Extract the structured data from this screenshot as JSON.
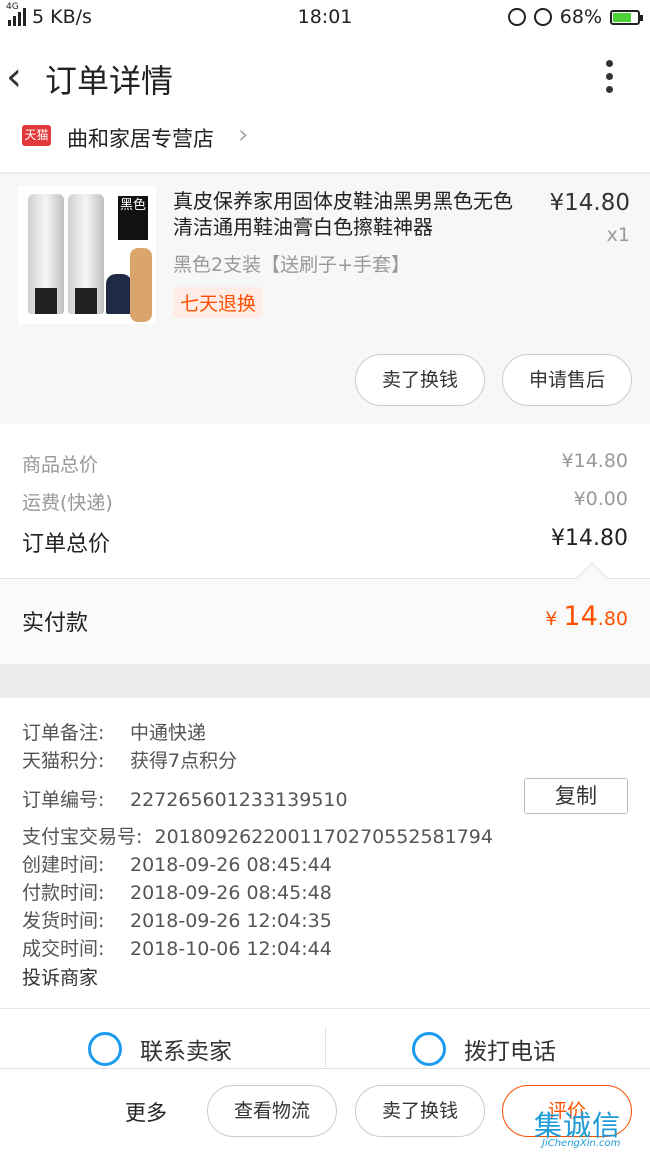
{
  "status_bar": {
    "network": "4G",
    "speed": "5 KB/s",
    "time": "18:01",
    "battery": "68%"
  },
  "nav": {
    "title": "订单详情"
  },
  "shop": {
    "badge": "天猫",
    "name": "曲和家居专营店"
  },
  "product": {
    "title": "真皮保养家用固体皮鞋油黑男黑色无色清洁通用鞋油膏白色擦鞋神器",
    "price": "¥14.80",
    "qty": "x1",
    "sku": "黑色2支装【送刷子+手套】",
    "tag": "七天退换",
    "image_label": "黑色",
    "actions": {
      "sell": "卖了换钱",
      "after_sale": "申请售后"
    }
  },
  "summary": {
    "goods_label": "商品总价",
    "goods_value": "¥14.80",
    "shipping_label": "运费(快递)",
    "shipping_value": "¥0.00",
    "total_label": "订单总价",
    "total_value": "¥14.80"
  },
  "paid": {
    "label": "实付款",
    "currency": "¥",
    "int": "14",
    "dec": ".80"
  },
  "info": {
    "remark": {
      "k": "订单备注:",
      "v": "中通快递"
    },
    "points": {
      "k": "天猫积分:",
      "v": "获得7点积分"
    },
    "order_no": {
      "k": "订单编号:",
      "v": "227265601233139510"
    },
    "copy": "复制",
    "alipay": {
      "k": "支付宝交易号:",
      "v": "2018092622001170270552581794"
    },
    "created": {
      "k": "创建时间:",
      "v": "2018-09-26 08:45:44"
    },
    "paid_time": {
      "k": "付款时间:",
      "v": "2018-09-26 08:45:48"
    },
    "shipped": {
      "k": "发货时间:",
      "v": "2018-09-26 12:04:35"
    },
    "closed": {
      "k": "成交时间:",
      "v": "2018-10-06 12:04:44"
    },
    "complain": "投诉商家"
  },
  "contact": {
    "seller": "联系卖家",
    "call": "拨打电话"
  },
  "bottom": {
    "more": "更多",
    "logistics": "查看物流",
    "sell": "卖了换钱",
    "rate": "评价"
  },
  "watermark": {
    "main": "集诚信",
    "sub": "JiChengXin.com"
  },
  "colors": {
    "accent": "#ff5000",
    "tmall": "#e4393c",
    "link_blue": "#1a9bf0"
  }
}
